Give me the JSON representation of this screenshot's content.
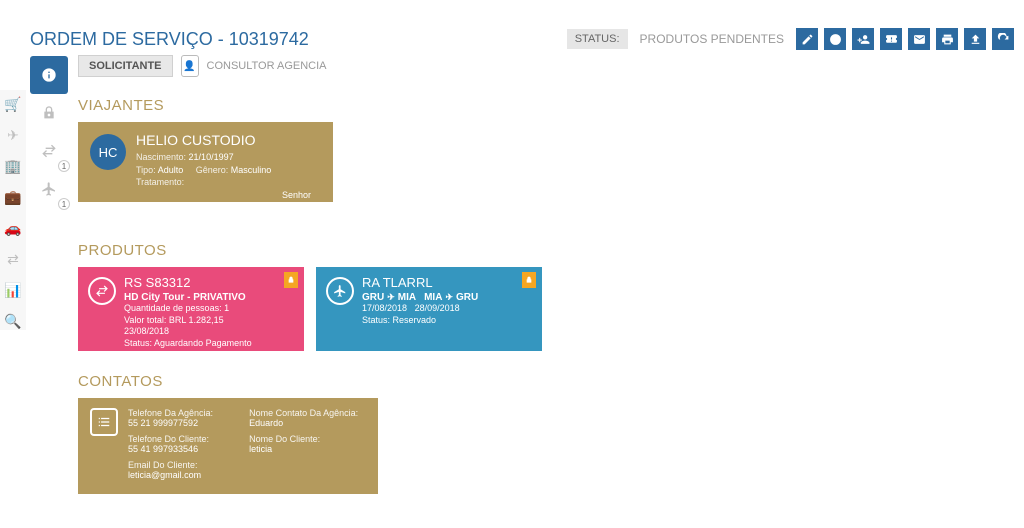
{
  "header": {
    "title": "ORDEM DE SERVIÇO - 10319742",
    "status_label": "STATUS:",
    "status_value": "PRODUTOS PENDENTES"
  },
  "solicitante": {
    "button_label": "SOLICITANTE",
    "consultant_label": "CONSULTOR AGENCIA"
  },
  "sections": {
    "travelers": "VIAJANTES",
    "products": "PRODUTOS",
    "contacts": "CONTATOS"
  },
  "traveler": {
    "initials": "HC",
    "name": "HELIO CUSTODIO",
    "birth_label": "Nascimento:",
    "birth_value": "21/10/1997",
    "type_label": "Tipo:",
    "type_value": "Adulto",
    "gender_label": "Gênero:",
    "gender_value": "Masculino",
    "treatment_label": "Tratamento:",
    "treatment_value": "Senhor"
  },
  "sidebar_badges": {
    "transfer": "1",
    "flight": "1"
  },
  "products": [
    {
      "code": "RS S83312",
      "name": "HD City Tour - PRIVATIVO",
      "people_label": "Quantidade de pessoas:",
      "people_value": "1",
      "value_label": "Valor total:",
      "value_value": "BRL 1.282,15",
      "date": "23/08/2018",
      "status_label": "Status:",
      "status_value": "Aguardando Pagamento"
    },
    {
      "code": "RA TLARRL",
      "route_from1": "GRU",
      "route_to1": "MIA",
      "route_from2": "MIA",
      "route_to2": "GRU",
      "date1": "17/08/2018",
      "date2": "28/09/2018",
      "status_label": "Status:",
      "status_value": "Reservado"
    }
  ],
  "contacts": {
    "agency_phone_label": "Telefone Da Agência:",
    "agency_phone_value": "55 21 999977592",
    "agency_contact_label": "Nome Contato Da Agência:",
    "agency_contact_value": "Eduardo",
    "client_phone_label": "Telefone Do Cliente:",
    "client_phone_value": "55 41 997933546",
    "client_name_label": "Nome Do Cliente:",
    "client_name_value": "leticia",
    "client_email_label": "Email Do Cliente:",
    "client_email_value": "leticia@gmail.com"
  }
}
